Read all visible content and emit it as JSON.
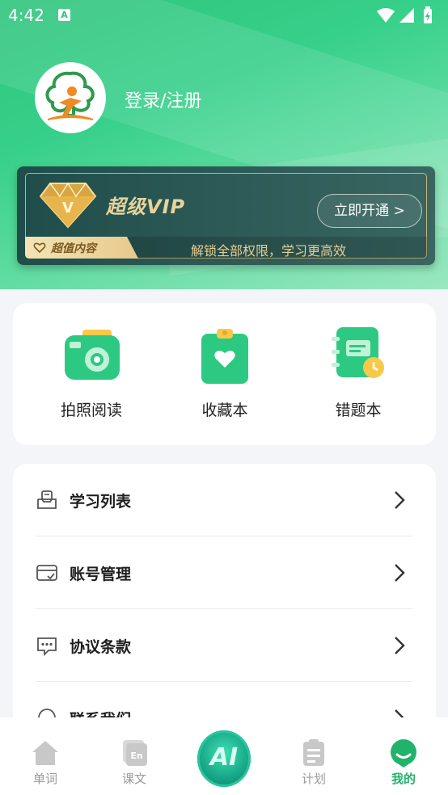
{
  "status_bar": {
    "time": "4:42",
    "sim_letter": "A"
  },
  "profile": {
    "login_label": "登录/注册"
  },
  "vip_card": {
    "title": "超级VIP",
    "open_button": "立即开通 >",
    "tag": "超值内容",
    "slogan": "解锁全部权限，学习更高效"
  },
  "quick_actions": [
    {
      "label": "拍照阅读",
      "icon": "camera-icon"
    },
    {
      "label": "收藏本",
      "icon": "favorites-clipboard-icon"
    },
    {
      "label": "错题本",
      "icon": "mistakes-notebook-icon"
    }
  ],
  "menu": [
    {
      "label": "学习列表",
      "icon": "study-list-icon"
    },
    {
      "label": "账号管理",
      "icon": "account-card-icon"
    },
    {
      "label": "协议条款",
      "icon": "agreement-chat-icon"
    },
    {
      "label": "联系我们",
      "icon": "headset-icon"
    }
  ],
  "tabbar": {
    "tabs": [
      {
        "label": "单词",
        "icon": "home-icon"
      },
      {
        "label": "课文",
        "icon": "text-en-icon"
      },
      {
        "label": "计划",
        "icon": "clipboard-icon"
      },
      {
        "label": "我的",
        "icon": "profile-smile-icon",
        "active": true
      }
    ],
    "ai_label": "AI"
  },
  "colors": {
    "accent": "#22b36b",
    "header_green": "#2fc47c",
    "vip_dark": "#2d5a56",
    "vip_gold": "#e6cf93"
  }
}
